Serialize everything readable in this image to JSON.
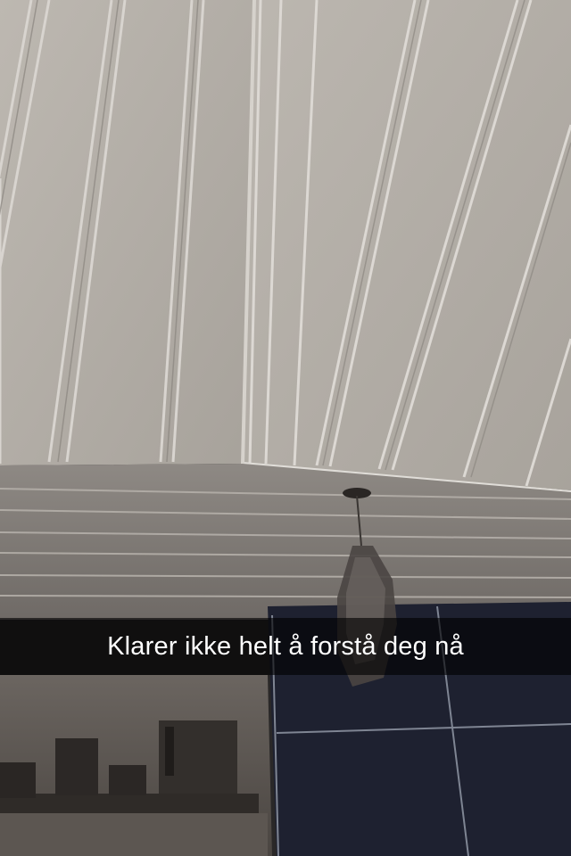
{
  "caption": {
    "text": "Klarer ikke helt å forstå deg nå"
  },
  "scene": {
    "description_icons": [
      "ceiling-panels",
      "pendant-lamp",
      "tiled-wall",
      "shelf-boxes"
    ],
    "colors": {
      "ceiling": "#b9b4ad",
      "wall": "#8f8a85",
      "tiles": "#1f2230",
      "grout": "#8e93a0",
      "shelf": "#3a3530"
    }
  }
}
